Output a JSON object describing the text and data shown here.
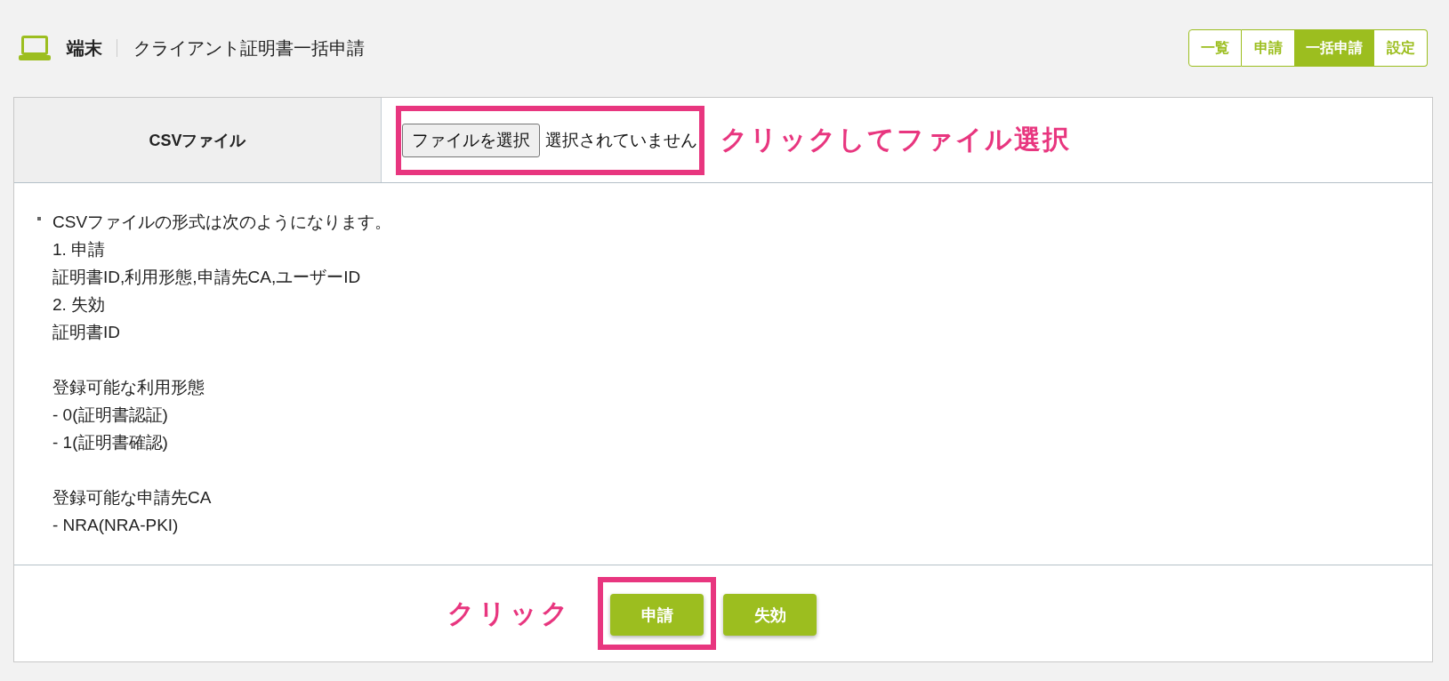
{
  "page_header": {
    "section": "端末",
    "title": "クライアント証明書一括申請"
  },
  "tabs": [
    {
      "label": "一覧",
      "selected": false
    },
    {
      "label": "申請",
      "selected": false
    },
    {
      "label": "一括申請",
      "selected": true
    },
    {
      "label": "設定",
      "selected": false
    }
  ],
  "csv_field": {
    "label": "CSVファイル",
    "button": "ファイルを選択",
    "status": "選択されていません",
    "highlighted": true,
    "note": "クリックしてファイル選択"
  },
  "instructions": {
    "paragraphs": [
      [
        "CSVファイルの形式は次のようになります。",
        "1. 申請",
        "証明書ID,利用形態,申請先CA,ユーザーID",
        "2. 失効",
        "証明書ID"
      ],
      [
        "登録可能な利用形態",
        "- 0(証明書認証)",
        "- 1(証明書確認)"
      ],
      [
        "登録可能な申請先CA",
        "- NRA(NRA-PKI)"
      ]
    ]
  },
  "actions": {
    "note": "クリック",
    "buttons": [
      {
        "label": "申請",
        "highlighted": true
      },
      {
        "label": "失効",
        "highlighted": false
      }
    ]
  }
}
